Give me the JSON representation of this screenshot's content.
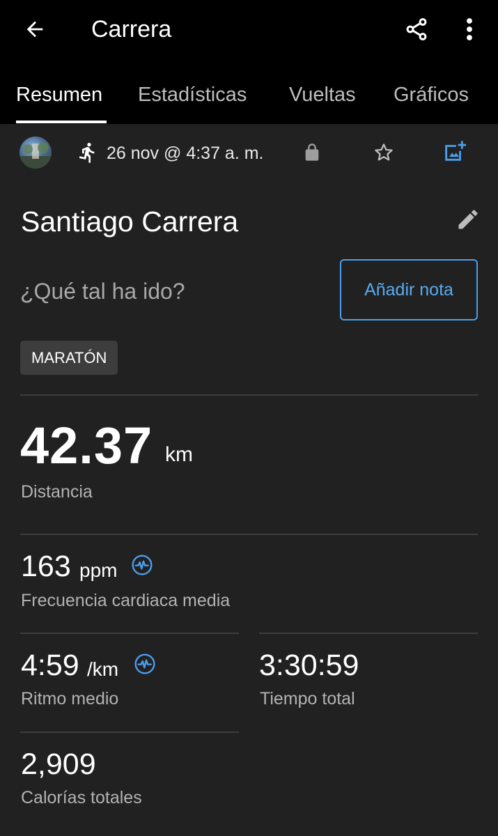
{
  "header": {
    "title": "Carrera",
    "back_icon": "arrow-left-icon",
    "share_icon": "share-icon",
    "more_icon": "more-vertical-icon"
  },
  "tabs": [
    {
      "label": "Resumen",
      "active": true
    },
    {
      "label": "Estadísticas",
      "active": false
    },
    {
      "label": "Vueltas",
      "active": false
    },
    {
      "label": "Gráficos",
      "active": false
    }
  ],
  "activity": {
    "date": "26 nov @ 4:37 a. m.",
    "name": "Santiago Carrera",
    "note_prompt": "¿Qué tal ha ido?",
    "add_note_label": "Añadir nota",
    "tag": "MARATÓN"
  },
  "stats": {
    "distance": {
      "value": "42.37",
      "unit": "km",
      "label": "Distancia"
    },
    "heart_rate": {
      "value": "163",
      "unit": "ppm",
      "label": "Frecuencia cardiaca media"
    },
    "pace": {
      "value": "4:59",
      "unit": "/km",
      "label": "Ritmo medio"
    },
    "total_time": {
      "value": "3:30:59",
      "label": "Tiempo total"
    },
    "calories": {
      "value": "2,909",
      "label": "Calorías totales"
    }
  },
  "colors": {
    "background": "#212121",
    "topbar": "#000000",
    "accent": "#4a9ff0",
    "tag_bg": "#3d3d3d",
    "muted_text": "#b3b3b3"
  }
}
